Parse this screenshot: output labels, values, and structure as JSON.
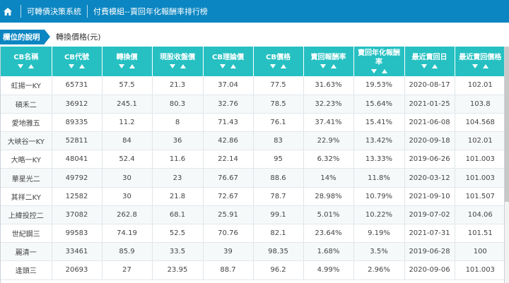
{
  "breadcrumb": {
    "system": "可轉債決策系統",
    "page": "付費模組--賣回年化報酬率排行榜"
  },
  "field": {
    "tag": "欄位的說明",
    "value": "轉換價格(元)"
  },
  "table": {
    "columns": [
      "CB名稱",
      "CB代號",
      "轉換價",
      "現股收盤價",
      "CB理論價",
      "CB價格",
      "賣回報酬率",
      "賣回年化報酬率",
      "最近賣回日",
      "最近賣回價格"
    ],
    "rows": [
      [
        "虹揚一KY",
        "65731",
        "57.5",
        "21.3",
        "37.04",
        "77.5",
        "31.63%",
        "19.53%",
        "2020-08-17",
        "102.01"
      ],
      [
        "碩禾二",
        "36912",
        "245.1",
        "80.3",
        "32.76",
        "78.5",
        "32.23%",
        "15.64%",
        "2021-01-25",
        "103.8"
      ],
      [
        "愛地雅五",
        "89335",
        "11.2",
        "8",
        "71.43",
        "76.1",
        "37.41%",
        "15.41%",
        "2021-06-08",
        "104.568"
      ],
      [
        "大峽谷一KY",
        "52811",
        "84",
        "36",
        "42.86",
        "83",
        "22.9%",
        "13.42%",
        "2020-09-18",
        "102.01"
      ],
      [
        "大略一KY",
        "48041",
        "52.4",
        "11.6",
        "22.14",
        "95",
        "6.32%",
        "13.33%",
        "2019-06-26",
        "101.003"
      ],
      [
        "華星光二",
        "49792",
        "30",
        "23",
        "76.67",
        "88.6",
        "14%",
        "11.8%",
        "2020-03-12",
        "101.003"
      ],
      [
        "其祥二KY",
        "12582",
        "30",
        "21.8",
        "72.67",
        "78.7",
        "28.98%",
        "10.79%",
        "2021-09-10",
        "101.507"
      ],
      [
        "上緯投控二",
        "37082",
        "262.8",
        "68.1",
        "25.91",
        "99.1",
        "5.01%",
        "10.22%",
        "2019-07-02",
        "104.06"
      ],
      [
        "世紀鋼三",
        "99583",
        "74.19",
        "52.5",
        "70.76",
        "82.1",
        "23.64%",
        "9.19%",
        "2021-07-31",
        "101.51"
      ],
      [
        "麗清一",
        "33461",
        "85.9",
        "33.5",
        "39",
        "98.35",
        "1.68%",
        "3.5%",
        "2019-06-28",
        "100"
      ],
      [
        "逢頭三",
        "20693",
        "27",
        "23.95",
        "88.7",
        "96.2",
        "4.99%",
        "2.96%",
        "2020-09-06",
        "101.003"
      ]
    ]
  },
  "colors": {
    "topbar": "#0b86c2",
    "header": "#26c0c2",
    "tag": "#0b86c2"
  },
  "icons": {
    "home": "home-icon",
    "sort_desc": "sort-descending-icon",
    "sort_asc": "sort-ascending-icon"
  }
}
